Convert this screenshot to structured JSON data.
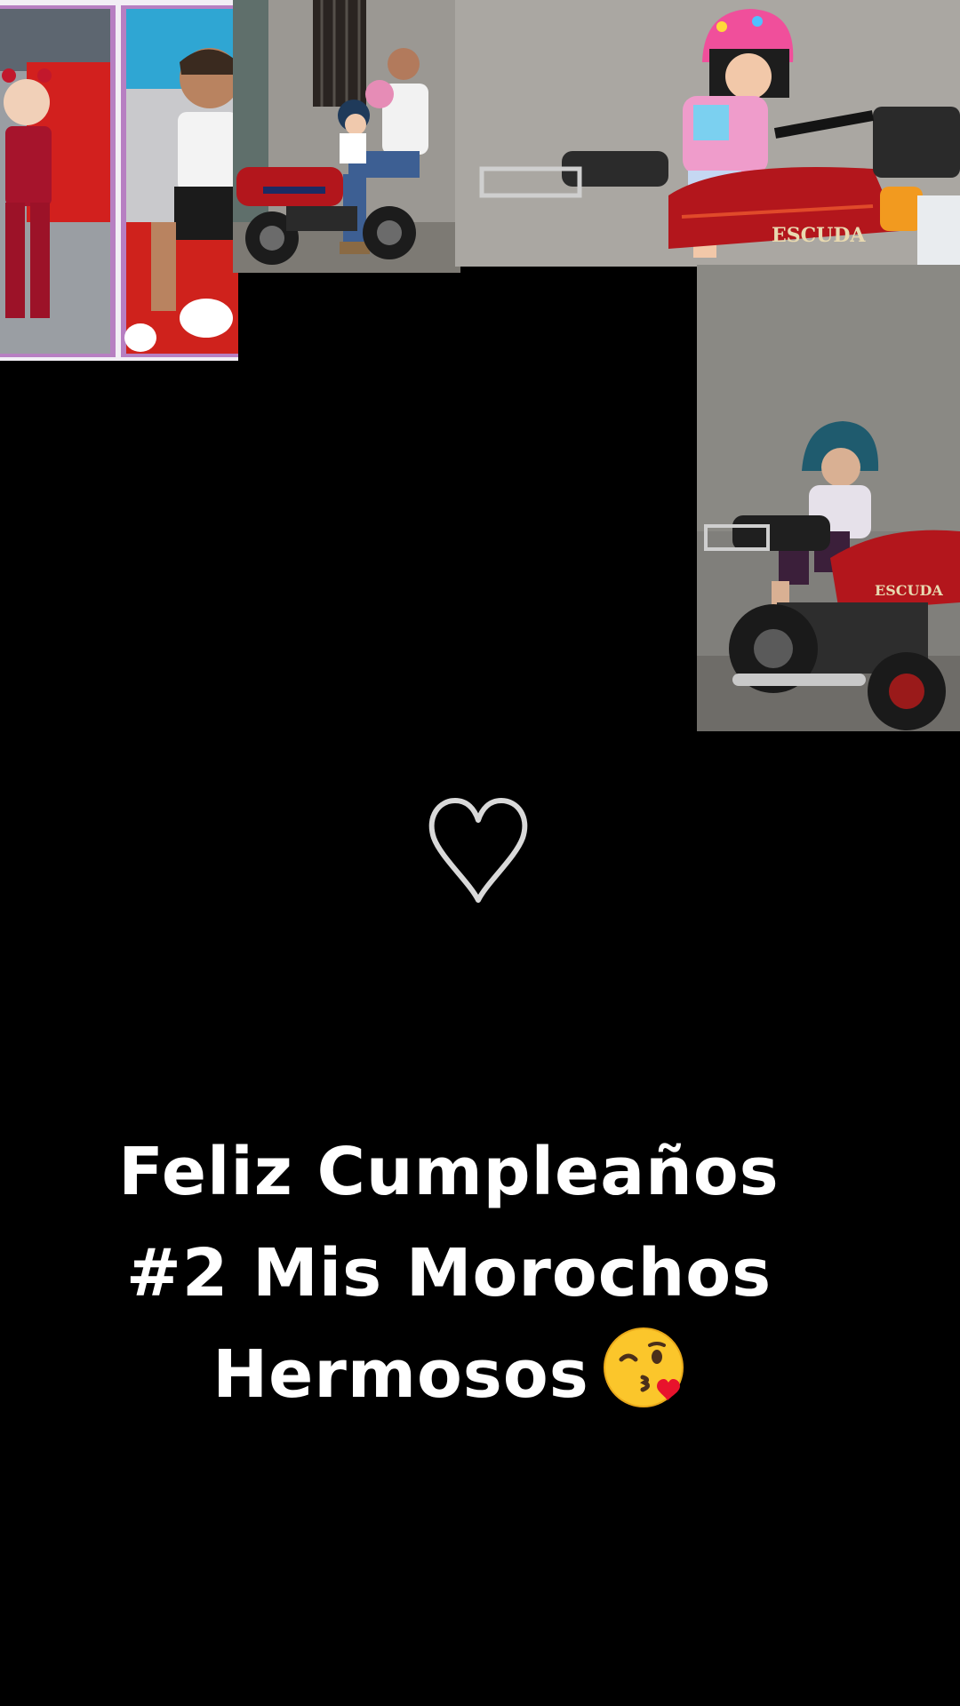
{
  "photos": [
    {
      "description_icon": "twins-on-red-car-photo"
    },
    {
      "description_icon": "father-with-twins-on-motorcycle-photo"
    },
    {
      "description_icon": "girl-pink-helmet-motorcycle-photo"
    },
    {
      "description_icon": "boy-teal-helmet-motorcycle-photo"
    }
  ],
  "motorcycle_badge": "ESCUDA",
  "heart_icon": "heart-outline-icon",
  "caption": {
    "line1": "Feliz Cumpleaños",
    "line2": "#2 Mis Morochos",
    "line3": "Hermosos",
    "emoji": "kissing-face-with-heart-icon"
  },
  "colors": {
    "background": "#000000",
    "text": "#ffffff",
    "heart_stroke": "#d9d9d9",
    "motorcycle_red": "#b3161c"
  }
}
